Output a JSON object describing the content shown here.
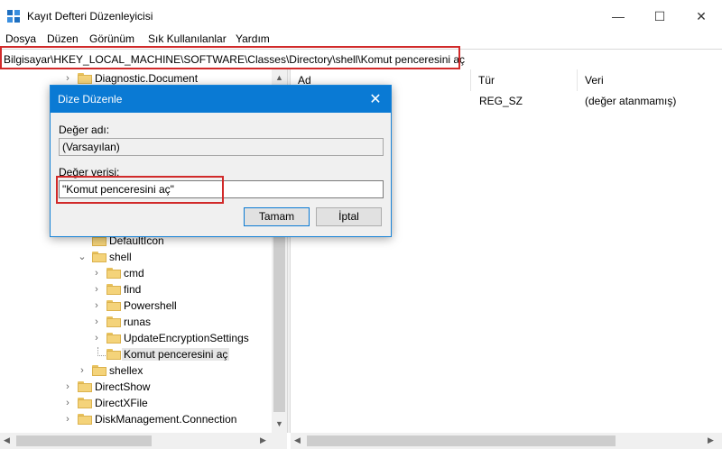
{
  "window": {
    "title": "Kayıt Defteri Düzenleyicisi",
    "minimize_glyph": "—",
    "maximize_glyph": "☐",
    "close_glyph": "✕"
  },
  "menu": [
    "Dosya",
    "Düzen",
    "Görünüm",
    "Sık Kullanılanlar",
    "Yardım"
  ],
  "address": "Bilgisayar\\HKEY_LOCAL_MACHINE\\SOFTWARE\\Classes\\Directory\\shell\\Komut penceresini aç",
  "tree": {
    "items": [
      "Diagnostic.Document",
      "DefaultIcon",
      "shell",
      "cmd",
      "find",
      "Powershell",
      "runas",
      "UpdateEncryptionSettings",
      "Komut penceresini aç",
      "shellex",
      "DirectShow",
      "DirectXFile",
      "DiskManagement.Connection"
    ]
  },
  "list": {
    "columns": [
      "Ad",
      "Tür",
      "Veri"
    ],
    "rows": [
      {
        "type": "REG_SZ",
        "data": "(değer atanmamış)"
      }
    ]
  },
  "dialog": {
    "title": "Dize Düzenle",
    "name_label": "Değer adı:",
    "name_value": "(Varsayılan)",
    "data_label": "Değer verisi:",
    "data_value": "\"Komut penceresini aç\"",
    "ok_label": "Tamam",
    "cancel_label": "İptal"
  },
  "colors": {
    "highlight_box": "#d12a2a",
    "dialog_titlebar": "#0a7ad4",
    "folder": "#f4d37a"
  }
}
